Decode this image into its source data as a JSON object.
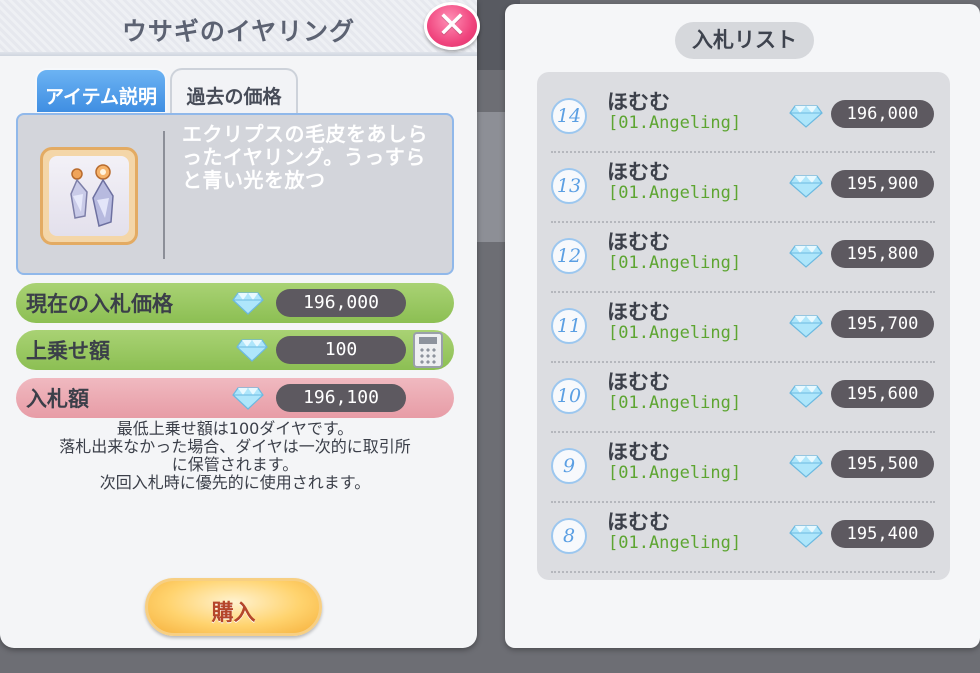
{
  "dialog": {
    "title": "ウサギのイヤリング",
    "close_label": "✕",
    "tabs": [
      {
        "label": "アイテム説明",
        "active": true
      },
      {
        "label": "過去の価格",
        "active": false
      }
    ],
    "description": "エクリプスの毛皮をあしらったイヤリング。うっすらと青い光を放つ",
    "current_bid": {
      "label": "現在の入札価格",
      "value": "196,000"
    },
    "increment": {
      "label": "上乗せ額",
      "value": "100"
    },
    "bid_amount": {
      "label": "入札額",
      "value": "196,100"
    },
    "notes": [
      "最低上乗せ額は100ダイヤです。",
      "落札出来なかった場合、ダイヤは一次的に取引所",
      "に保管されます。",
      "次回入札時に優先的に使用されます。"
    ],
    "buy_label": "購入"
  },
  "bid_list": {
    "title": "入札リスト",
    "items": [
      {
        "rank": "14",
        "name": "ほむむ",
        "guild": "[01.Angeling]",
        "amount": "196,000"
      },
      {
        "rank": "13",
        "name": "ほむむ",
        "guild": "[01.Angeling]",
        "amount": "195,900"
      },
      {
        "rank": "12",
        "name": "ほむむ",
        "guild": "[01.Angeling]",
        "amount": "195,800"
      },
      {
        "rank": "11",
        "name": "ほむむ",
        "guild": "[01.Angeling]",
        "amount": "195,700"
      },
      {
        "rank": "10",
        "name": "ほむむ",
        "guild": "[01.Angeling]",
        "amount": "195,600"
      },
      {
        "rank": "9",
        "name": "ほむむ",
        "guild": "[01.Angeling]",
        "amount": "195,500"
      },
      {
        "rank": "8",
        "name": "ほむむ",
        "guild": "[01.Angeling]",
        "amount": "195,400"
      }
    ]
  },
  "icons": {
    "currency": "diamond-icon",
    "calculator": "calculator-icon",
    "item": "earring-icon",
    "close": "close-icon"
  },
  "colors": {
    "accent_blue": "#4a97e6",
    "close_pink": "#f0457e",
    "row_green": "#8cbf53",
    "row_pink": "#e79ca6",
    "guild_green": "#5da531",
    "buy_gold": "#ffd36e"
  }
}
